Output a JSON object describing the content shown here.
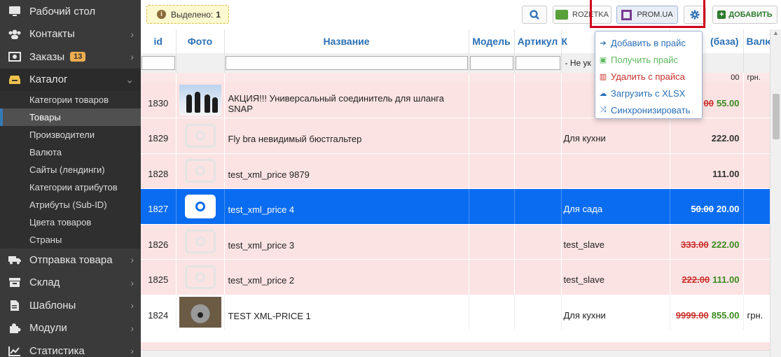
{
  "sidebar": {
    "items": [
      {
        "label": "Рабочий стол",
        "icon": "monitor-icon",
        "chevron": false
      },
      {
        "label": "Контакты",
        "icon": "users-icon",
        "chevron": true
      },
      {
        "label": "Заказы",
        "icon": "money-icon",
        "chevron": true,
        "badge": "13"
      },
      {
        "label": "Каталог",
        "icon": "inbox-icon",
        "chevron": true,
        "active": true
      }
    ],
    "catalog_sub": [
      "Категории товаров",
      "Товары",
      "Производители",
      "Валюта",
      "Сайты (лендинги)",
      "Категории атрибутов",
      "Атрибуты (Sub-ID)",
      "Цвета товаров",
      "Страны"
    ],
    "current_sub_index": 1,
    "items_after": [
      {
        "label": "Отправка товара",
        "icon": "truck-icon"
      },
      {
        "label": "Склад",
        "icon": "archive-icon"
      },
      {
        "label": "Шаблоны",
        "icon": "file-icon"
      },
      {
        "label": "Модули",
        "icon": "puzzle-icon"
      },
      {
        "label": "Статистика",
        "icon": "chart-icon"
      }
    ]
  },
  "toolbar": {
    "selected_label": "Выделено:",
    "selected_count": "1",
    "rozetka_label": "ROZETKA",
    "prom_label": "PROM.UA",
    "add_label": "ДОБАВИТЬ"
  },
  "table": {
    "headers": [
      "id",
      "Фото",
      "Название",
      "Модель",
      "Артикул",
      "К",
      "(база)",
      "Валю"
    ],
    "filter_select": "- Не ук",
    "rows": [
      {
        "id": "1830",
        "photo": "penguins",
        "name": "АКЦИЯ!!! Универсальный соединитель для шланга SNAP",
        "cat": "",
        "old": "00",
        "new": "55.00",
        "cur": "",
        "style": "pink"
      },
      {
        "id": "1829",
        "photo": "placeholder",
        "name": "Fly bra невидимый бюстгальтер",
        "cat": "Для кухни",
        "old": "",
        "new": "222.00",
        "cur": "",
        "style": "pink"
      },
      {
        "id": "1828",
        "photo": "placeholder",
        "name": "test_xml_price 9879",
        "cat": "",
        "old": "",
        "new": "111.00",
        "cur": "",
        "style": "pink"
      },
      {
        "id": "1827",
        "photo": "placeholder",
        "name": "test_xml_price 4",
        "cat": "Для сада",
        "old": "50.00",
        "new": "20.00",
        "cur": "",
        "style": "selected"
      },
      {
        "id": "1826",
        "photo": "placeholder",
        "name": "test_xml_price 3",
        "cat": "test_slave",
        "old": "333.00",
        "new": "222.00",
        "cur": "",
        "style": "pink"
      },
      {
        "id": "1825",
        "photo": "placeholder",
        "name": "test_xml_price 2",
        "cat": "test_slave",
        "old": "222.00",
        "new": "111.00",
        "cur": "",
        "style": "pink"
      },
      {
        "id": "1824",
        "photo": "koala",
        "name": "TEST XML-PRICE 1",
        "cat": "Для кухни",
        "old": "9999.00",
        "new": "855.00",
        "cur": "грн.",
        "style": "white"
      }
    ],
    "partial_top_price": "00",
    "partial_top_cur": "грн."
  },
  "dropdown": {
    "items": [
      {
        "label": "Добавить в прайс",
        "icon": "sign-in-icon",
        "tone": "blue"
      },
      {
        "label": "Получить прайс",
        "icon": "excel-icon",
        "tone": "green"
      },
      {
        "label": "Удалить с прайса",
        "icon": "trash-icon",
        "tone": "red"
      },
      {
        "label": "Загрузить с XLSX",
        "icon": "cloud-upload-icon",
        "tone": "blue"
      },
      {
        "label": "Синхронизировать",
        "icon": "shuffle-icon",
        "tone": "blue"
      }
    ]
  }
}
